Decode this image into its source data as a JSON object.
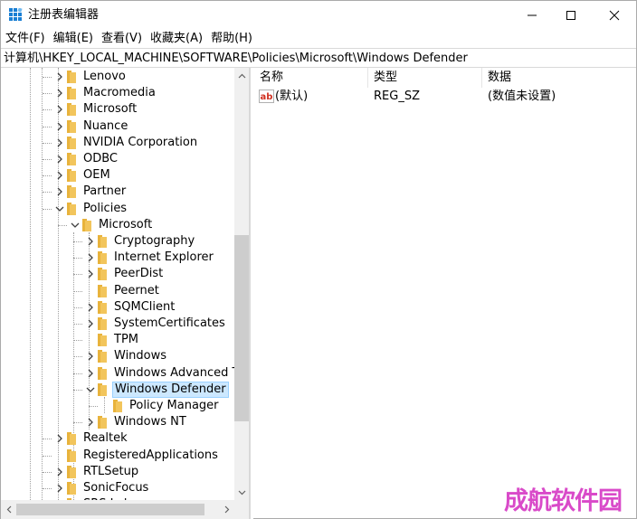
{
  "window": {
    "title": "注册表编辑器",
    "minimize_icon": "minimize-icon",
    "maximize_icon": "maximize-icon",
    "close_icon": "close-icon"
  },
  "menu": [
    {
      "label": "文件(F)"
    },
    {
      "label": "编辑(E)"
    },
    {
      "label": "查看(V)"
    },
    {
      "label": "收藏夹(A)"
    },
    {
      "label": "帮助(H)"
    }
  ],
  "address": {
    "path": "计算机\\HKEY_LOCAL_MACHINE\\SOFTWARE\\Policies\\Microsoft\\Windows Defender"
  },
  "tree": {
    "items": [
      {
        "label": "Lenovo",
        "expander": "collapsed",
        "selected": false
      },
      {
        "label": "Macromedia",
        "expander": "collapsed",
        "selected": false
      },
      {
        "label": "Microsoft",
        "expander": "collapsed",
        "selected": false
      },
      {
        "label": "Nuance",
        "expander": "collapsed",
        "selected": false
      },
      {
        "label": "NVIDIA Corporation",
        "expander": "collapsed",
        "selected": false
      },
      {
        "label": "ODBC",
        "expander": "collapsed",
        "selected": false
      },
      {
        "label": "OEM",
        "expander": "collapsed",
        "selected": false
      },
      {
        "label": "Partner",
        "expander": "collapsed",
        "selected": false
      },
      {
        "label": "Policies",
        "expander": "expanded",
        "selected": false
      },
      {
        "label": "Microsoft",
        "expander": "expanded",
        "selected": false
      },
      {
        "label": "Cryptography",
        "expander": "collapsed",
        "selected": false
      },
      {
        "label": "Internet Explorer",
        "expander": "collapsed",
        "selected": false
      },
      {
        "label": "PeerDist",
        "expander": "collapsed",
        "selected": false
      },
      {
        "label": "Peernet",
        "expander": "none",
        "selected": false
      },
      {
        "label": "SQMClient",
        "expander": "collapsed",
        "selected": false
      },
      {
        "label": "SystemCertificates",
        "expander": "collapsed",
        "selected": false
      },
      {
        "label": "TPM",
        "expander": "none",
        "selected": false
      },
      {
        "label": "Windows",
        "expander": "collapsed",
        "selected": false
      },
      {
        "label": "Windows Advanced Threat Protection",
        "expander": "collapsed",
        "selected": false
      },
      {
        "label": "Windows Defender",
        "expander": "expanded",
        "selected": true
      },
      {
        "label": "Policy Manager",
        "expander": "none",
        "selected": false
      },
      {
        "label": "Windows NT",
        "expander": "collapsed",
        "selected": false
      },
      {
        "label": "Realtek",
        "expander": "collapsed",
        "selected": false
      },
      {
        "label": "RegisteredApplications",
        "expander": "none",
        "selected": false
      },
      {
        "label": "RTLSetup",
        "expander": "collapsed",
        "selected": false
      },
      {
        "label": "SonicFocus",
        "expander": "collapsed",
        "selected": false
      },
      {
        "label": "SRS Labs",
        "expander": "collapsed",
        "selected": false
      }
    ]
  },
  "values": {
    "columns": {
      "name": "名称",
      "type": "类型",
      "data": "数据"
    },
    "rows": [
      {
        "name": "(默认)",
        "type": "REG_SZ",
        "data": "(数值未设置)",
        "icon": "string-value-icon"
      }
    ]
  },
  "colors": {
    "selection_bg": "#cce8ff",
    "selection_border": "#99d1ff",
    "folder_yellow": "#f2c55c",
    "scrollbar_track": "#f0f0f0",
    "scrollbar_thumb": "#cdcdcd",
    "watermark": "#d94ac9"
  },
  "watermark": {
    "text": "成航软件园"
  }
}
